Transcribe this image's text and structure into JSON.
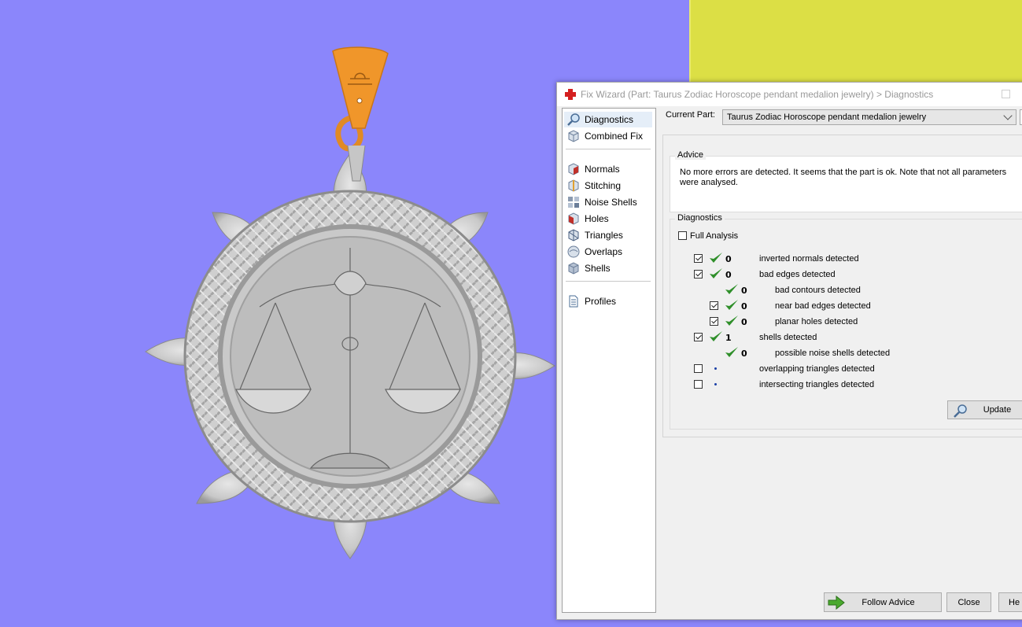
{
  "colors": {
    "viewport_bg": "#8b86fb",
    "yellow_panel": "#dcdf45",
    "bail": "#f0962a",
    "metal": "#c4c4c4",
    "accent_check": "#2f8f2a"
  },
  "dialog": {
    "title": "Fix Wizard (Part: Taurus Zodiac Horoscope pendant medalion jewelry) > Diagnostics",
    "nav": {
      "top_items": [
        {
          "label": "Diagnostics",
          "icon": "magnifier-icon"
        },
        {
          "label": "Combined Fix",
          "icon": "cube-icon"
        }
      ],
      "tool_items": [
        {
          "label": "Normals",
          "icon": "normals-cube-icon"
        },
        {
          "label": "Stitching",
          "icon": "stitching-cube-icon"
        },
        {
          "label": "Noise Shells",
          "icon": "noise-shells-icon"
        },
        {
          "label": "Holes",
          "icon": "holes-cube-icon"
        },
        {
          "label": "Triangles",
          "icon": "triangles-cube-icon"
        },
        {
          "label": "Overlaps",
          "icon": "overlaps-cube-icon"
        },
        {
          "label": "Shells",
          "icon": "shells-cube-icon"
        }
      ],
      "bottom_items": [
        {
          "label": "Profiles",
          "icon": "document-icon"
        }
      ]
    },
    "current_part_label": "Current Part:",
    "current_part_value": "Taurus Zodiac Horoscope pendant medalion jewelry",
    "advice_title": "Advice",
    "advice_text": "No more errors are detected. It seems that the part is ok. Note that not all parameters were analysed.",
    "diagnostics_title": "Diagnostics",
    "full_analysis_label": "Full Analysis",
    "rows": [
      {
        "checked": true,
        "status": "ok",
        "count": "0",
        "label": "inverted normals detected"
      },
      {
        "checked": true,
        "status": "ok",
        "count": "0",
        "label": "bad edges detected"
      },
      {
        "checked": null,
        "status": "ok",
        "count": "0",
        "label": "bad contours detected"
      },
      {
        "checked": true,
        "status": "ok",
        "count": "0",
        "label": "near bad edges detected"
      },
      {
        "checked": true,
        "status": "ok",
        "count": "0",
        "label": "planar holes detected"
      },
      {
        "checked": true,
        "status": "ok",
        "count": "1",
        "label": "shells detected"
      },
      {
        "checked": null,
        "status": "ok",
        "count": "0",
        "label": "possible noise shells detected"
      },
      {
        "checked": false,
        "status": "pending",
        "count": "",
        "label": "overlapping triangles detected"
      },
      {
        "checked": false,
        "status": "pending",
        "count": "",
        "label": "intersecting triangles detected"
      }
    ],
    "buttons": {
      "update": "Update",
      "follow_advice": "Follow Advice",
      "close": "Close",
      "help": "He"
    }
  }
}
